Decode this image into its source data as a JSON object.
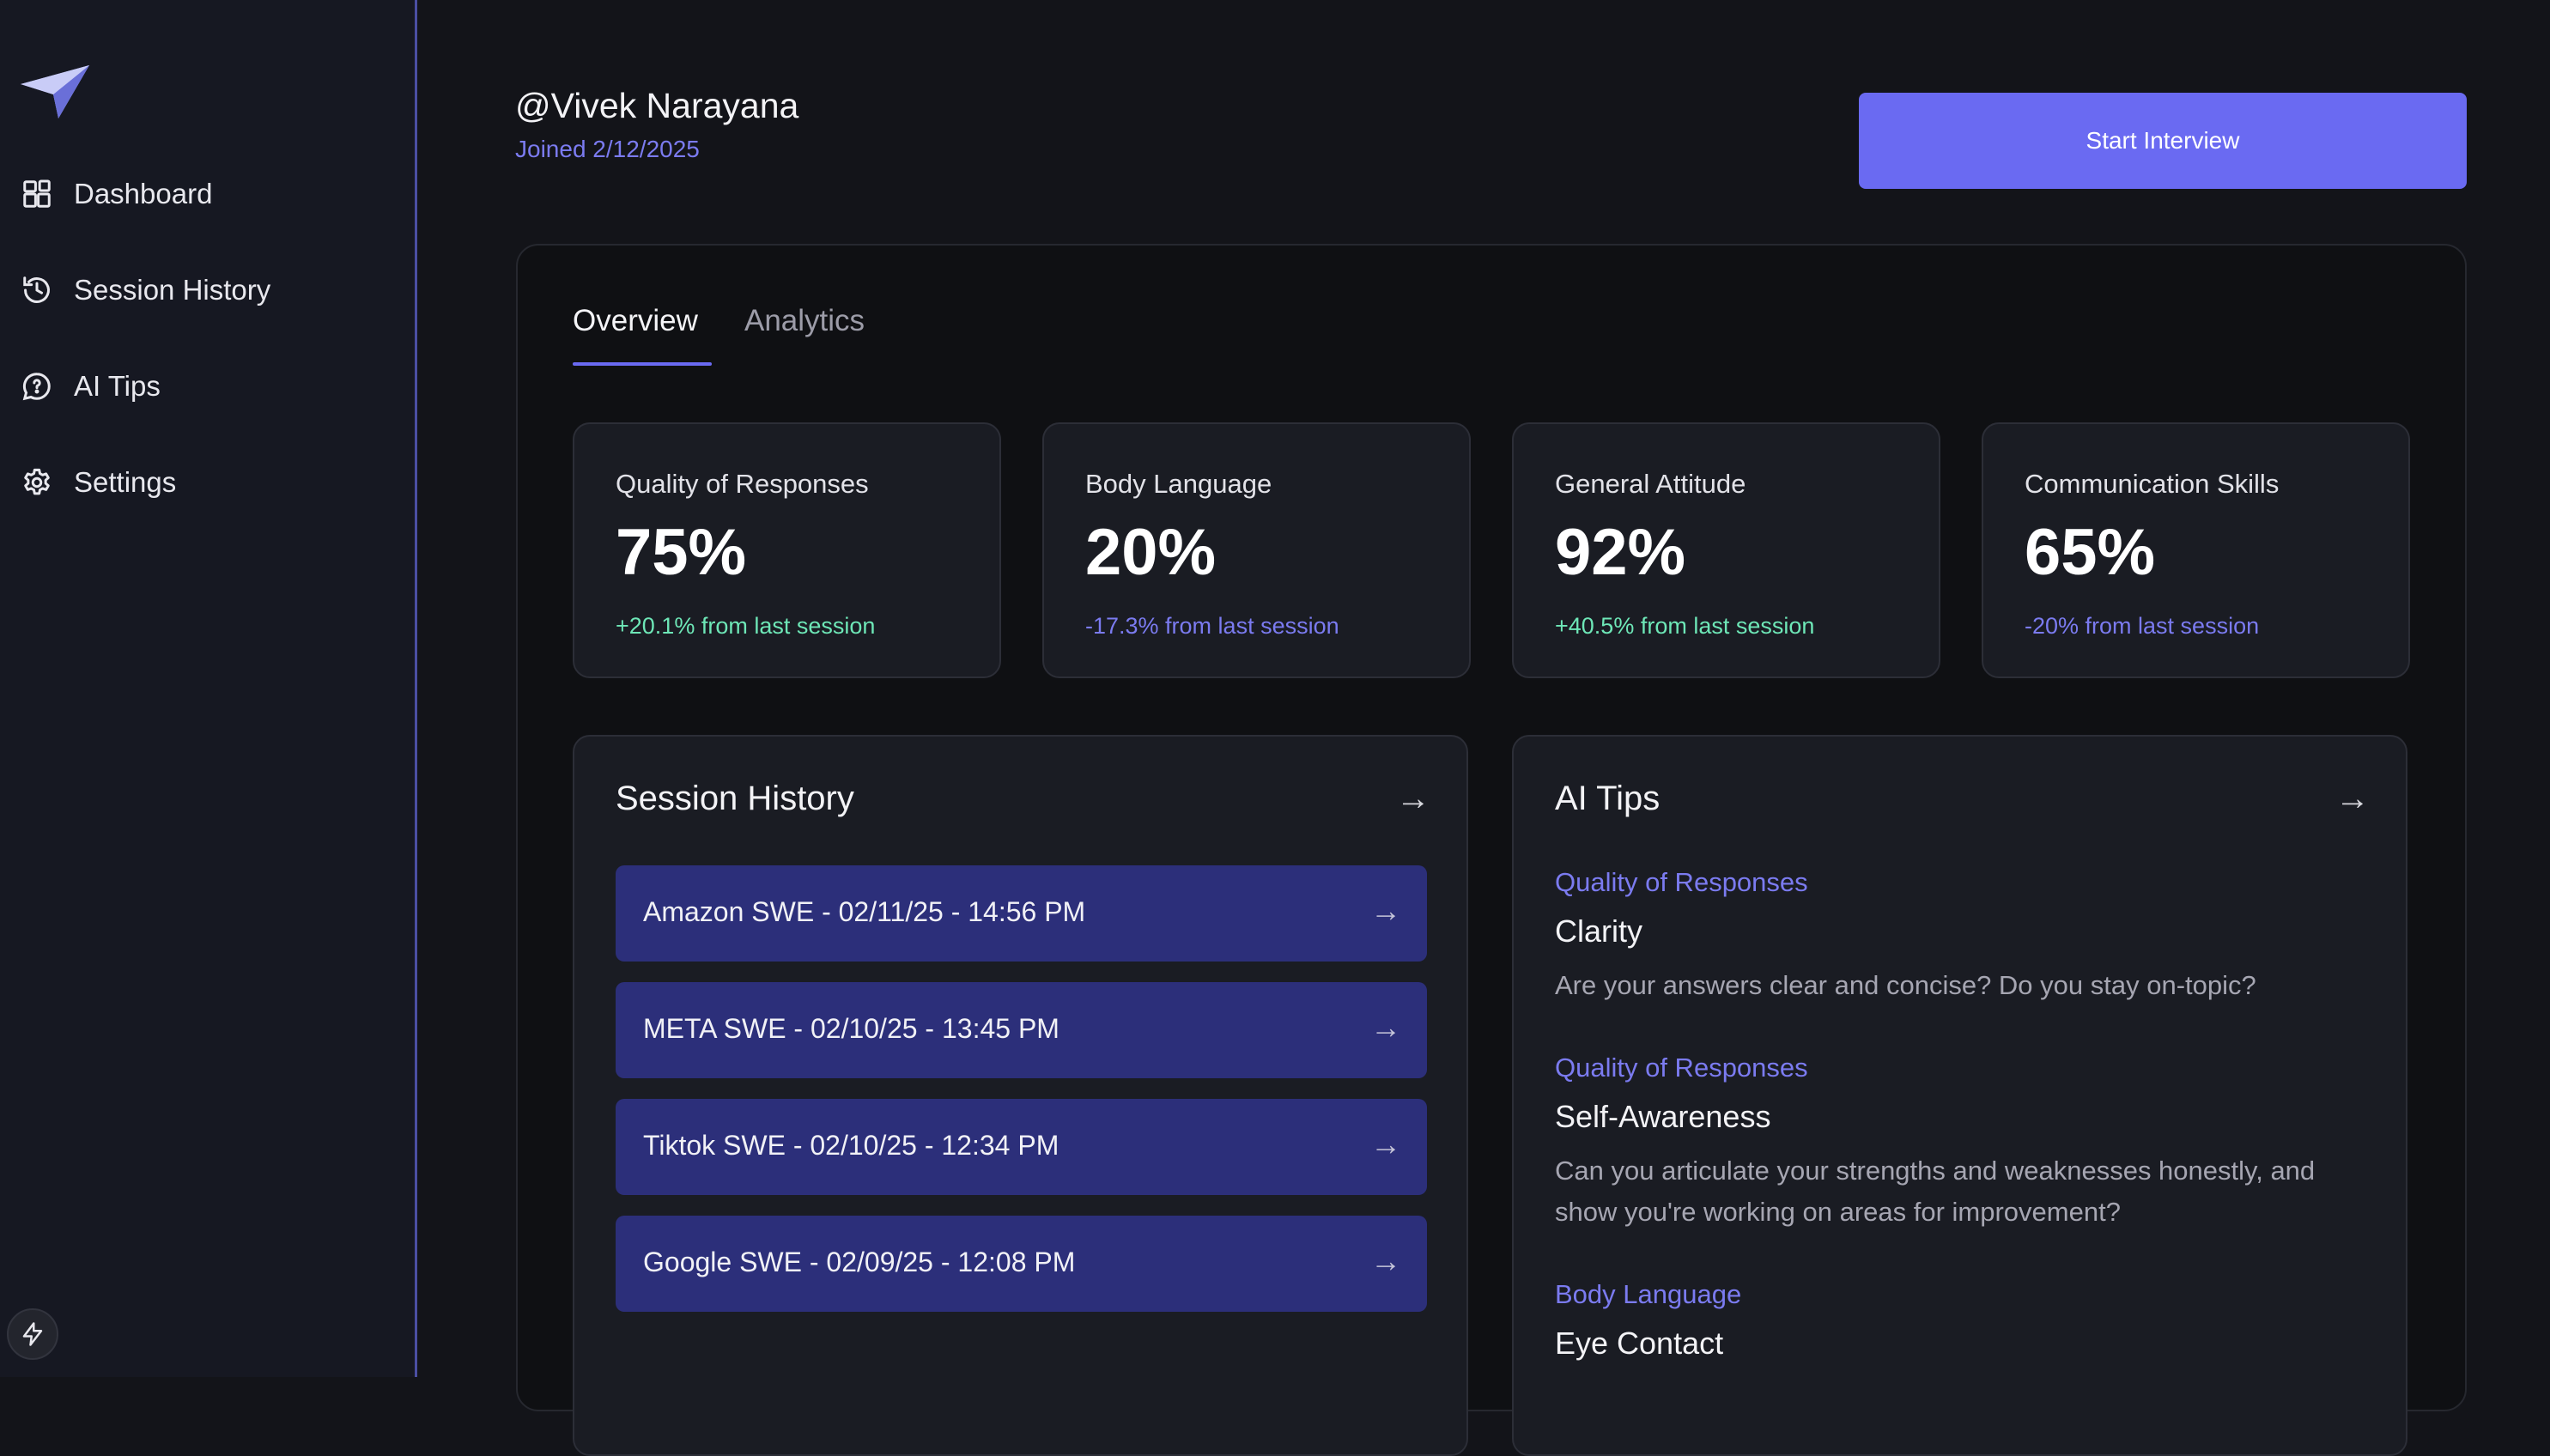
{
  "sidebar": {
    "logo_icon": "paper-plane-icon",
    "items": [
      {
        "label": "Dashboard",
        "icon": "dashboard-icon"
      },
      {
        "label": "Session History",
        "icon": "history-icon"
      },
      {
        "label": "AI Tips",
        "icon": "chat-bubble-icon"
      },
      {
        "label": "Settings",
        "icon": "gear-icon"
      }
    ],
    "bottom_icon": "lightning-icon"
  },
  "header": {
    "user_name": "@Vivek Narayana",
    "joined": "Joined 2/12/2025",
    "start_button": "Start Interview"
  },
  "tabs": [
    {
      "label": "Overview",
      "active": true
    },
    {
      "label": "Analytics",
      "active": false
    }
  ],
  "stats": [
    {
      "title": "Quality of Responses",
      "value": "75%",
      "change": "+20.1% from last session",
      "trend": "up"
    },
    {
      "title": "Body Language",
      "value": "20%",
      "change": "-17.3% from last session",
      "trend": "down"
    },
    {
      "title": "General Attitude",
      "value": "92%",
      "change": "+40.5% from last session",
      "trend": "up"
    },
    {
      "title": "Communication Skills",
      "value": "65%",
      "change": "-20% from last session",
      "trend": "down"
    }
  ],
  "session_history": {
    "title": "Session History",
    "arrow": "→",
    "items": [
      {
        "label": "Amazon SWE - 02/11/25 - 14:56 PM",
        "arrow": "→"
      },
      {
        "label": "META SWE - 02/10/25 - 13:45 PM",
        "arrow": "→"
      },
      {
        "label": "Tiktok SWE - 02/10/25 - 12:34 PM",
        "arrow": "→"
      },
      {
        "label": "Google SWE - 02/09/25 - 12:08 PM",
        "arrow": "→"
      }
    ]
  },
  "ai_tips": {
    "title": "AI Tips",
    "arrow": "→",
    "items": [
      {
        "category": "Quality of Responses",
        "title": "Clarity",
        "description": "Are your answers clear and concise? Do you stay on-topic?"
      },
      {
        "category": "Quality of Responses",
        "title": "Self-Awareness",
        "description": "Can you articulate your strengths and weaknesses honestly, and show you're working on areas for improvement?"
      },
      {
        "category": "Body Language",
        "title": "Eye Contact",
        "description": ""
      }
    ]
  },
  "colors": {
    "accent": "#6a6af2",
    "positive": "#6ee7b7",
    "background": "#131419",
    "session_item": "#2c2f7a"
  }
}
